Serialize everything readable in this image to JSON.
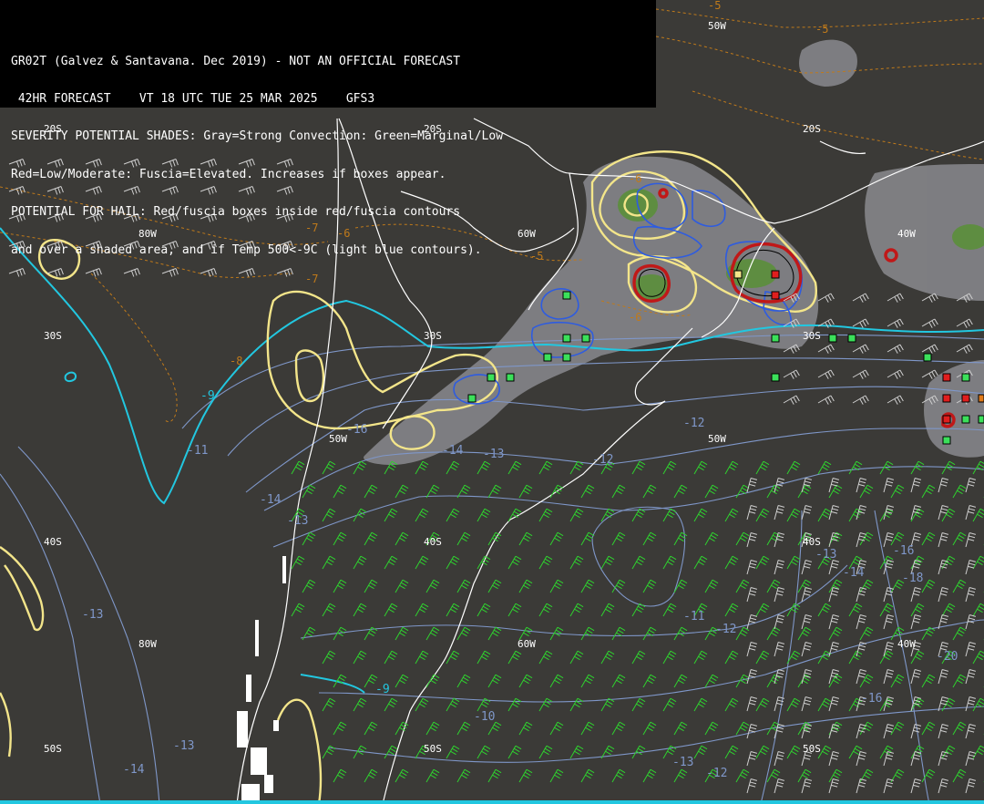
{
  "header": {
    "lines": [
      "GR02T (Galvez & Santavana. Dec 2019) - NOT AN OFFICIAL FORECAST",
      " 42HR FORECAST    VT 18 UTC TUE 25 MAR 2025    GFS3",
      "SEVERITY POTENTIAL SHADES: Gray=Strong Convection: Green=Marginal/Low",
      "Red=Low/Moderate: Fuscia=Elevated. Increases if boxes appear.",
      "POTENTIAL FOR HAIL: Red/fuscia boxes inside red/fuscia contours",
      "and over a shaded area, and if Temp 500<-9C (light blue contours)."
    ]
  },
  "grid_labels": {
    "lon_80w_top": "80W",
    "lon_60w_top": "60W",
    "lon_50w_top": "50W",
    "lon_50w_top2": "50W",
    "lon_40w_top": "40W",
    "lon_80w_bottom": "80W",
    "lon_60w_bottom": "60W",
    "lon_40w_bottom": "40W",
    "lat_20s_a": "20S",
    "lat_20s_b": "20S",
    "lat_20s_c": "20S",
    "lat_30s_a": "30S",
    "lat_30s_b": "30S",
    "lat_30s_c": "30S",
    "lat_40s_a": "40S",
    "lat_40s_b": "40S",
    "lat_40s_c": "40S",
    "lat_50s_a": "50S",
    "lat_50s_b": "50S",
    "lat_50s_c": "50S"
  },
  "temperature_labels": {
    "c1": "-9",
    "c2": "-9",
    "b1": "-11",
    "b2": "-14",
    "b3": "-13",
    "b4": "-16",
    "b5": "-14",
    "b6": "-13",
    "b7": "-12",
    "b8": "-12",
    "b9": "-13",
    "b10": "-11",
    "b11": "-12",
    "b12": "-10",
    "b13": "-13",
    "b14": "-14",
    "b15": "-16",
    "b16": "-18",
    "b17": "-13",
    "b18": "-14",
    "b19": "-20",
    "b20": "-16",
    "b21": "-13",
    "b22": "-12",
    "o1": "-5",
    "o2": "-5",
    "o3": "-8",
    "o4": "-7",
    "o5": "-6",
    "o6": "-6",
    "o7": "-8",
    "o8": "-5",
    "o9": "-6"
  },
  "colors": {
    "background": "#3b3a37",
    "coast": "#ffffff",
    "temp_500_cold": "#22c7e0",
    "temp_500": "#7f97c9",
    "thickness_orange": "#c07a1a",
    "instability_yellow": "#f3e58a",
    "blue_contour": "#2e5ce0",
    "red_contour": "#c01818",
    "gray_shade": "#8a8a8e",
    "green_shade": "#5b8f3a",
    "wind_green": "#2fd12f",
    "wind_white": "#cfcfcf",
    "box_green": "#3be05a",
    "box_red": "#e01e1e",
    "box_orange": "#e07a1a"
  }
}
